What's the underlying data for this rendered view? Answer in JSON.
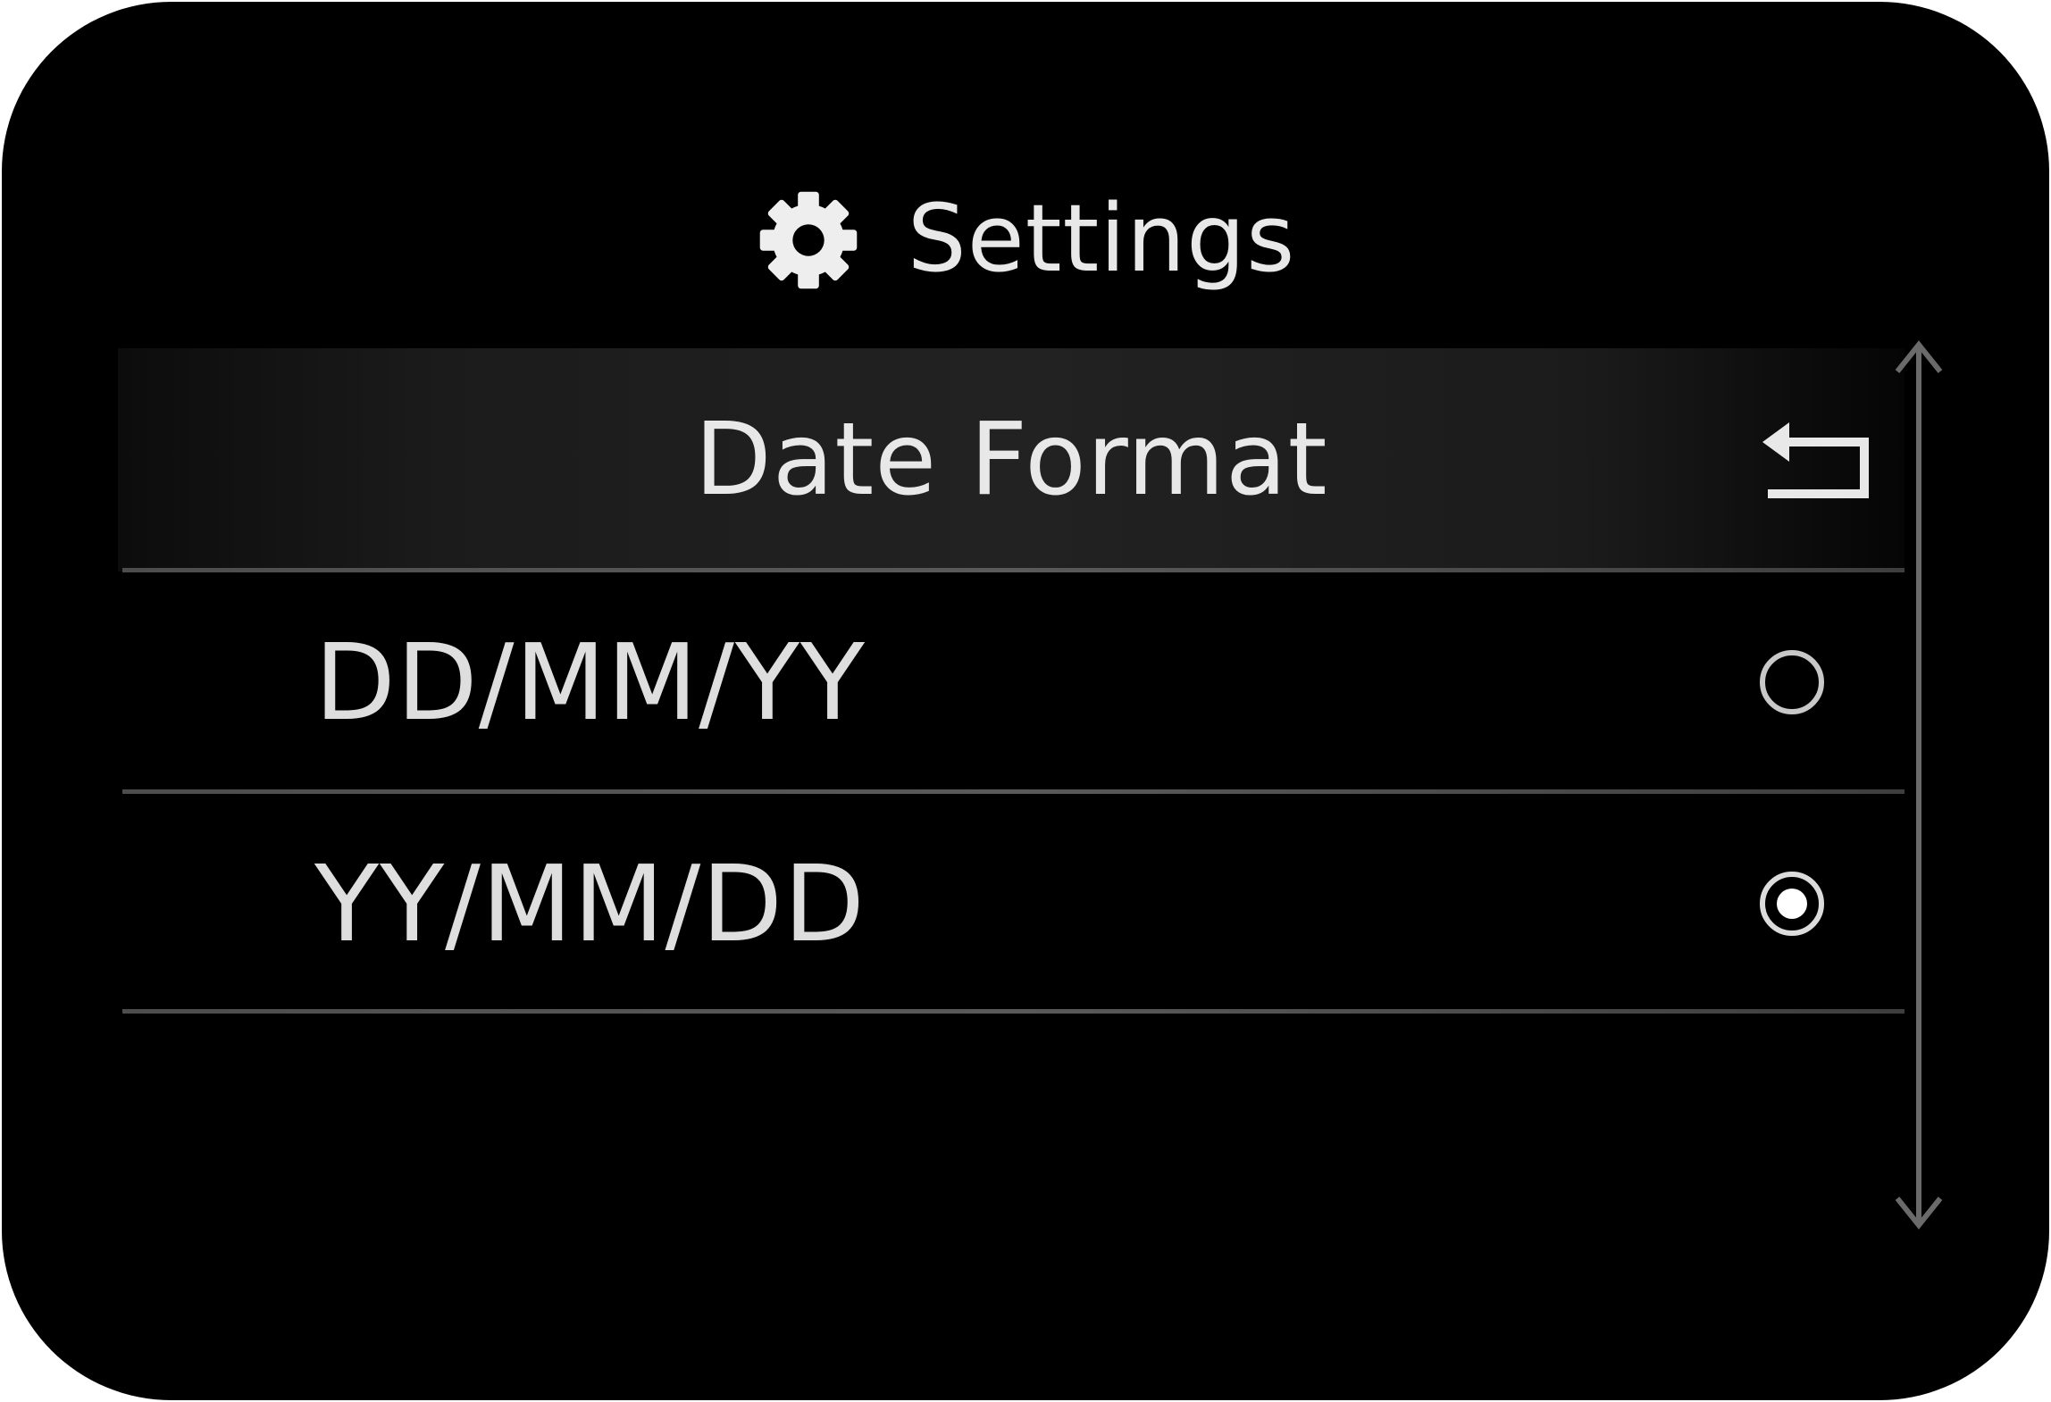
{
  "header": {
    "title": "Settings",
    "icon": "gear-icon"
  },
  "subheader": {
    "title": "Date Format",
    "back_icon": "back-icon"
  },
  "options": [
    {
      "label": "DD/MM/YY",
      "selected": false
    },
    {
      "label": "YY/MM/DD",
      "selected": true
    }
  ],
  "scrollbar": {
    "up_icon": "arrow-up-icon",
    "down_icon": "arrow-down-icon"
  },
  "colors": {
    "background": "#000000",
    "text": "#e8e8e8",
    "divider": "#555555"
  }
}
